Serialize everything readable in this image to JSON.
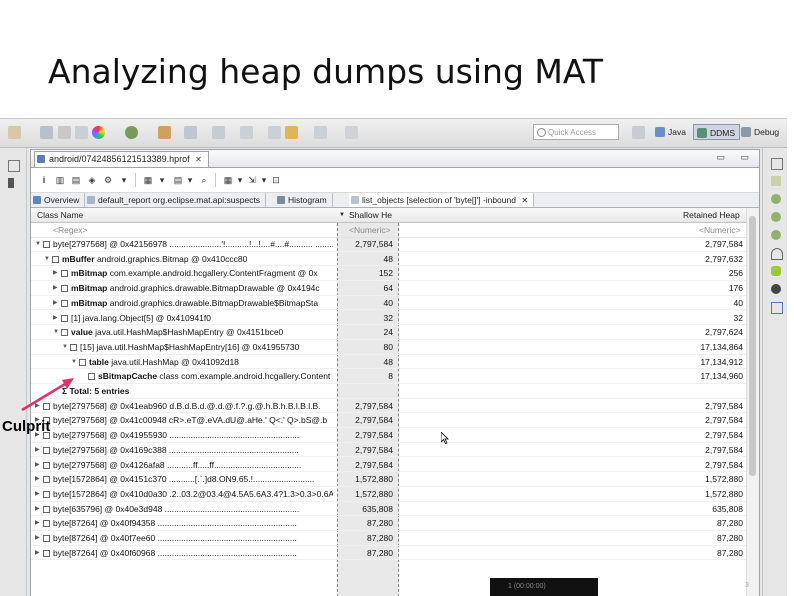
{
  "slide": {
    "title": "Analyzing heap dumps using MAT",
    "annotation": "Culprit",
    "footer": "1 (00:00:00)"
  },
  "toolbar": {
    "quick_access_placeholder": "Quick Access",
    "perspectives": [
      "Java",
      "DDMS",
      "Debug"
    ]
  },
  "editor": {
    "file_tab": "android/07424856121513389.hprof",
    "sub_tabs": [
      "Overview",
      "default_report org.eclipse.mat.api:suspects",
      "Histogram",
      "list_objects [selection of 'byte[]'] -inbound"
    ],
    "columns": {
      "class_name": "Class Name",
      "shallow_heap": "Shallow He",
      "retained_heap": "Retained Heap"
    },
    "filters": {
      "class_name": "<Regex>",
      "shallow": "<Numeric>",
      "retained": "<Numeric>"
    },
    "rows": [
      {
        "level": 0,
        "twisty": "▼",
        "prefix": "byte[2797568] @ 0x42156978 ",
        "bold": "",
        "rest": "......................'!..........!...!....#....#.......... ..........&&",
        "shallow": "2,797,584",
        "retained": "2,797,584"
      },
      {
        "level": 1,
        "twisty": "▼",
        "prefix": "",
        "bold": "mBuffer",
        "rest": " android.graphics.Bitmap @ 0x410ccc80",
        "shallow": "48",
        "retained": "2,797,632"
      },
      {
        "level": 2,
        "twisty": "▶",
        "prefix": "",
        "bold": "mBitmap",
        "rest": " com.example.android.hcgallery.ContentFragment @ 0x",
        "shallow": "152",
        "retained": "256"
      },
      {
        "level": 2,
        "twisty": "▶",
        "prefix": "",
        "bold": "mBitmap",
        "rest": " android.graphics.drawable.BitmapDrawable @ 0x4194c",
        "shallow": "64",
        "retained": "176"
      },
      {
        "level": 2,
        "twisty": "▶",
        "prefix": "",
        "bold": "mBitmap",
        "rest": " android.graphics.drawable.BitmapDrawable$BitmapSta",
        "shallow": "40",
        "retained": "40"
      },
      {
        "level": 2,
        "twisty": "▶",
        "prefix": "[1] java.lang.Object[5] @ 0x410941f0",
        "bold": "",
        "rest": "",
        "shallow": "32",
        "retained": "32"
      },
      {
        "level": 2,
        "twisty": "▼",
        "prefix": "",
        "bold": "value",
        "rest": " java.util.HashMap$HashMapEntry @ 0x4151bce0",
        "shallow": "24",
        "retained": "2,797,624"
      },
      {
        "level": 3,
        "twisty": "▼",
        "prefix": "[15] java.util.HashMap$HashMapEntry[16] @ 0x41955730",
        "bold": "",
        "rest": "",
        "shallow": "80",
        "retained": "17,134,864"
      },
      {
        "level": 4,
        "twisty": "▼",
        "prefix": "",
        "bold": "table",
        "rest": " java.util.HashMap @ 0x41092d18",
        "shallow": "48",
        "retained": "17,134,912"
      },
      {
        "level": 5,
        "twisty": "",
        "prefix": "",
        "bold": "sBitmapCache",
        "rest": " class com.example.android.hcgallery.Content",
        "shallow": "8",
        "retained": "17,134,960"
      },
      {
        "level": 1,
        "twisty": "",
        "prefix": "Σ ",
        "bold": "Total: 5 entries",
        "rest": "",
        "shallow": "",
        "retained": ""
      },
      {
        "level": 0,
        "twisty": "▶",
        "prefix": "byte[2797568] @ 0x41eab960 d.B.d.B.d.@.d.@.f.?.g.@.h.B.h.B.l.B.l.B.",
        "bold": "",
        "rest": "",
        "shallow": "2,797,584",
        "retained": "2,797,584"
      },
      {
        "level": 0,
        "twisty": "▶",
        "prefix": "byte[2797568] @ 0x41c00948 cR>.eT@.eVA.dU@.aHe.' Q<.' Q>.bS@.b",
        "bold": "",
        "rest": "",
        "shallow": "2,797,584",
        "retained": "2,797,584"
      },
      {
        "level": 0,
        "twisty": "▶",
        "prefix": "byte[2797568] @ 0x41955930 .......................................................",
        "bold": "",
        "rest": "",
        "shallow": "2,797,584",
        "retained": "2,797,584"
      },
      {
        "level": 0,
        "twisty": "▶",
        "prefix": "byte[2797568] @ 0x4169c388 .......................................................",
        "bold": "",
        "rest": "",
        "shallow": "2,797,584",
        "retained": "2,797,584"
      },
      {
        "level": 0,
        "twisty": "▶",
        "prefix": "byte[2797568] @ 0x4126afa8 ...........ff.....ff.....................................",
        "bold": "",
        "rest": "",
        "shallow": "2,797,584",
        "retained": "2,797,584"
      },
      {
        "level": 0,
        "twisty": "▶",
        "prefix": "byte[1572864] @ 0x4151c370 ...........[.`.]d8.ON9.65.!..........................",
        "bold": "",
        "rest": "",
        "shallow": "1,572,880",
        "retained": "1,572,880"
      },
      {
        "level": 0,
        "twisty": "▶",
        "prefix": "byte[1572864] @ 0x410d0a30 .2..03.2@03.4@4.5A5.6A3.4?1.3>0.3>0.6A",
        "bold": "",
        "rest": "",
        "shallow": "1,572,880",
        "retained": "1,572,880"
      },
      {
        "level": 0,
        "twisty": "▶",
        "prefix": "byte[635796] @ 0x40e3d948 .........................................................",
        "bold": "",
        "rest": "",
        "shallow": "635,808",
        "retained": "635,808"
      },
      {
        "level": 0,
        "twisty": "▶",
        "prefix": "byte[87264] @ 0x40f94358 ...........................................................",
        "bold": "",
        "rest": "",
        "shallow": "87,280",
        "retained": "87,280"
      },
      {
        "level": 0,
        "twisty": "▶",
        "prefix": "byte[87264] @ 0x40f7ee60 ...........................................................",
        "bold": "",
        "rest": "",
        "shallow": "87,280",
        "retained": "87,280"
      },
      {
        "level": 0,
        "twisty": "▶",
        "prefix": "byte[87264] @ 0x40f60968 ...........................................................",
        "bold": "",
        "rest": "",
        "shallow": "87,280",
        "retained": "87,280"
      }
    ]
  },
  "colors": {
    "annotation_arrow": "#e0306a",
    "active_tab": "#ffffff",
    "shallow_column_bg": "#e9e9e9"
  },
  "icons": [
    "new-icon",
    "save-icon",
    "print-icon",
    "color-wheel-icon",
    "debug-icon",
    "run-icon",
    "search-icon",
    "java-perspective-icon",
    "ddms-perspective-icon",
    "debug-perspective-icon",
    "object-icon",
    "array-icon"
  ]
}
